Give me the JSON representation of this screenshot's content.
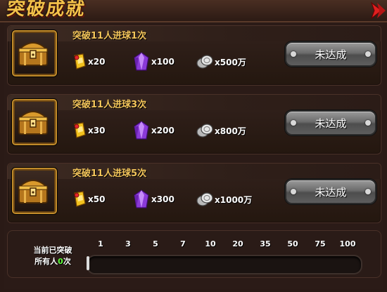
{
  "header": {
    "title": "突破成就"
  },
  "achievements": [
    {
      "title": "突破11人进球1次",
      "rewards": [
        {
          "icon": "ticket-icon",
          "amount": "x20"
        },
        {
          "icon": "purple-gem-icon",
          "amount": "x100"
        },
        {
          "icon": "silver-coins-icon",
          "amount": "x500万"
        }
      ],
      "button": "未达成"
    },
    {
      "title": "突破11人进球3次",
      "rewards": [
        {
          "icon": "ticket-icon",
          "amount": "x30"
        },
        {
          "icon": "purple-gem-icon",
          "amount": "x200"
        },
        {
          "icon": "silver-coins-icon",
          "amount": "x800万"
        }
      ],
      "button": "未达成"
    },
    {
      "title": "突破11人进球5次",
      "rewards": [
        {
          "icon": "ticket-icon",
          "amount": "x50"
        },
        {
          "icon": "purple-gem-icon",
          "amount": "x300"
        },
        {
          "icon": "silver-coins-icon",
          "amount": "x1000万"
        }
      ],
      "button": "未达成"
    }
  ],
  "progress": {
    "label_line1": "当前已突破",
    "label_prefix": "所有人",
    "count": "0",
    "label_suffix": "次",
    "ticks": [
      "1",
      "3",
      "5",
      "7",
      "10",
      "20",
      "35",
      "50",
      "75",
      "100"
    ],
    "fill_fraction": 0
  },
  "colors": {
    "gold_text": "#f2c45a",
    "highlight_green": "#5dff3a",
    "accent_red": "#e02020"
  }
}
